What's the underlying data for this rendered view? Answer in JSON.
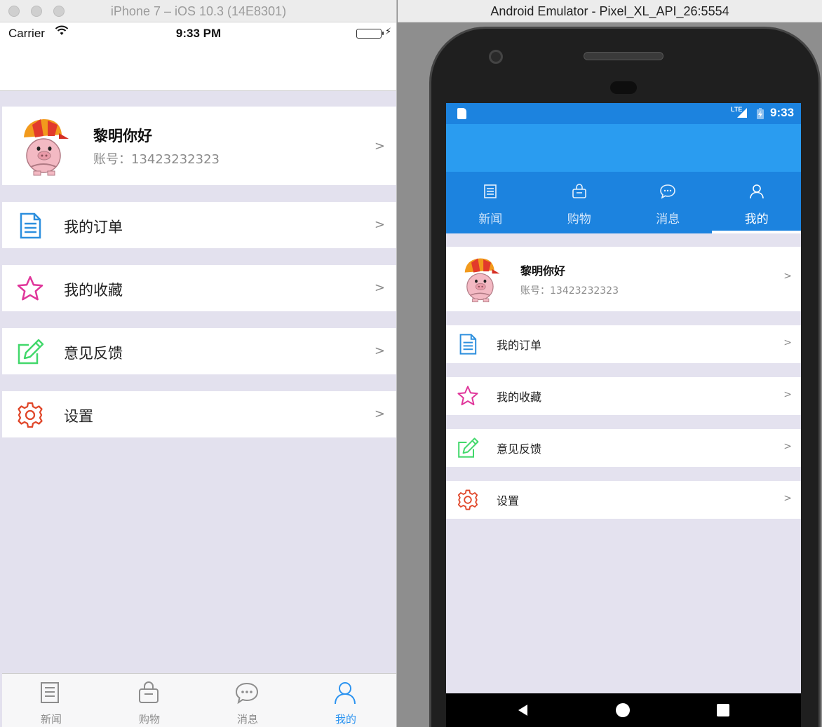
{
  "ios": {
    "window_title": "iPhone 7 – iOS 10.3 (14E8301)",
    "status": {
      "carrier": "Carrier",
      "time": "9:33 PM",
      "battery_icon": "battery-full-icon",
      "bolt": "⚡"
    },
    "profile": {
      "name": "黎明你好",
      "account": "账号：13423232323",
      "chevron": ">"
    },
    "menu": [
      {
        "label": "我的订单",
        "icon": "document-icon",
        "color": "#2d8fde",
        "chevron": ">"
      },
      {
        "label": "我的收藏",
        "icon": "star-icon",
        "color": "#e0359a",
        "chevron": ">"
      },
      {
        "label": "意见反馈",
        "icon": "edit-icon",
        "color": "#42d86b",
        "chevron": ">"
      },
      {
        "label": "设置",
        "icon": "gear-icon",
        "color": "#e0472a",
        "chevron": ">"
      }
    ],
    "tabs": [
      {
        "label": "新闻",
        "icon": "news-icon"
      },
      {
        "label": "购物",
        "icon": "shopping-bag-icon"
      },
      {
        "label": "消息",
        "icon": "message-icon"
      },
      {
        "label": "我的",
        "icon": "person-icon",
        "active": true
      }
    ],
    "colors": {
      "accent": "#2b93f0",
      "background": "#e3e1ee"
    }
  },
  "android": {
    "window_title": "Android Emulator - Pixel_XL_API_26:5554",
    "status": {
      "time": "9:33",
      "network": "LTE"
    },
    "tabs": [
      {
        "label": "新闻",
        "icon": "news-icon"
      },
      {
        "label": "购物",
        "icon": "shopping-bag-icon"
      },
      {
        "label": "消息",
        "icon": "message-icon"
      },
      {
        "label": "我的",
        "icon": "person-icon",
        "active": true
      }
    ],
    "profile": {
      "name": "黎明你好",
      "account": "账号：13423232323",
      "chevron": ">"
    },
    "menu": [
      {
        "label": "我的订单",
        "icon": "document-icon",
        "chevron": ">"
      },
      {
        "label": "我的收藏",
        "icon": "star-icon",
        "chevron": ">"
      },
      {
        "label": "意见反馈",
        "icon": "edit-icon",
        "chevron": ">"
      },
      {
        "label": "设置",
        "icon": "gear-icon",
        "chevron": ">"
      }
    ],
    "colors": {
      "status_bar": "#1c83df",
      "action_bar": "#2a9cf0",
      "tab_bar": "#1c83df"
    }
  }
}
